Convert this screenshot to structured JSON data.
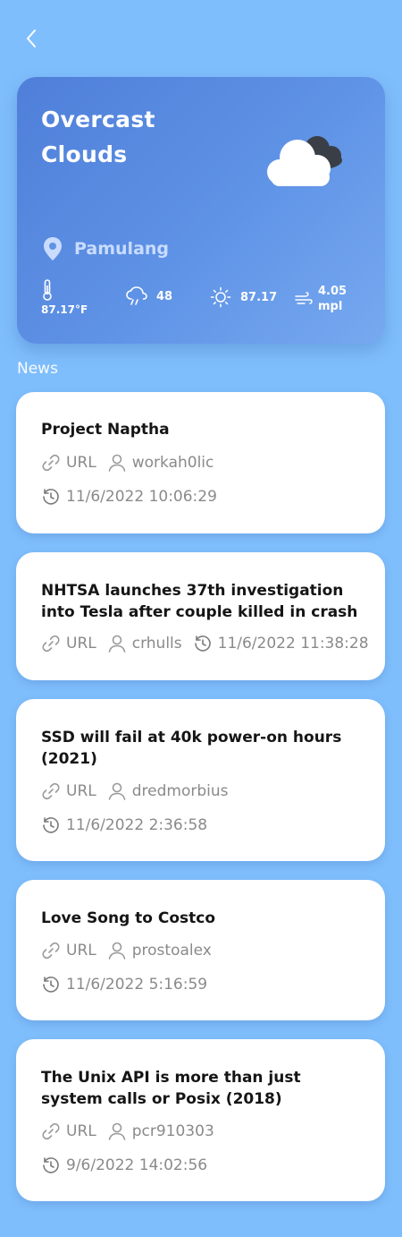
{
  "header": {
    "back_icon": "chevron-left-icon"
  },
  "weather": {
    "condition": "Overcast Clouds",
    "location": "Pamulang",
    "stats": {
      "temperature": "87.17°F",
      "humidity": "48",
      "feels_like": "87.17",
      "wind": "4.05 mpl"
    },
    "colors": {
      "card_start": "#4f7fd9",
      "card_end": "#77a9f0",
      "background": "#7fbefc"
    }
  },
  "news": {
    "section_label": "News",
    "items": [
      {
        "title": "Project Naptha",
        "url_label": "URL",
        "author": "workah0lic",
        "time": "11/6/2022 10:06:29"
      },
      {
        "title": "NHTSA launches 37th investigation into Tesla after couple killed in crash",
        "url_label": "URL",
        "author": "crhulls",
        "time": "11/6/2022 11:38:28"
      },
      {
        "title": "SSD will fail at 40k power-on hours (2021)",
        "url_label": "URL",
        "author": "dredmorbius",
        "time": "11/6/2022 2:36:58"
      },
      {
        "title": "Love Song to Costco",
        "url_label": "URL",
        "author": "prostoalex",
        "time": "11/6/2022 5:16:59"
      },
      {
        "title": "The Unix API is more than just system calls or Posix (2018)",
        "url_label": "URL",
        "author": "pcr910303",
        "time": "9/6/2022 14:02:56"
      }
    ]
  }
}
